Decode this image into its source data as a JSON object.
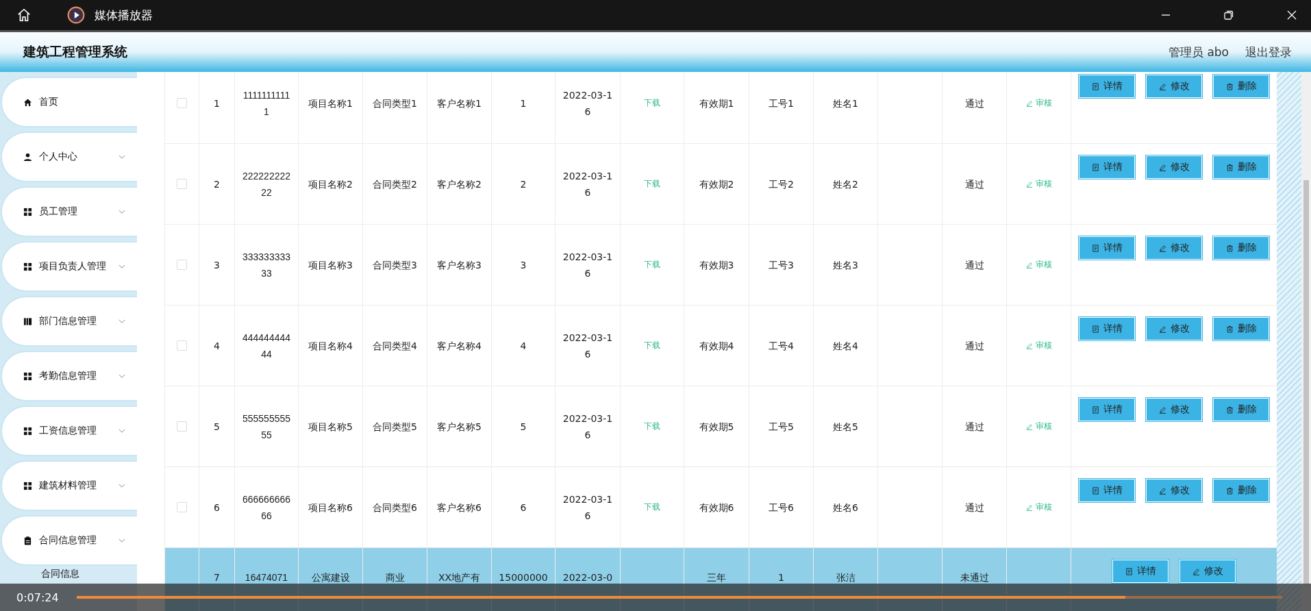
{
  "player": {
    "title": "媒体播放器",
    "time": "0:07:24",
    "level": 0.87
  },
  "header": {
    "title": "建筑工程管理系统",
    "user": "管理员 abo",
    "logout": "退出登录"
  },
  "sidebar": {
    "items": [
      {
        "label": "首页",
        "kind": "link"
      },
      {
        "label": "个人中心",
        "kind": "menu"
      },
      {
        "label": "员工管理",
        "kind": "menu"
      },
      {
        "label": "项目负责人管理",
        "kind": "menu"
      },
      {
        "label": "部门信息管理",
        "kind": "menu"
      },
      {
        "label": "考勤信息管理",
        "kind": "menu"
      },
      {
        "label": "工资信息管理",
        "kind": "menu"
      },
      {
        "label": "建筑材料管理",
        "kind": "menu"
      },
      {
        "label": "合同信息管理",
        "kind": "menu",
        "children": [
          {
            "label": "合同信息"
          }
        ]
      }
    ]
  },
  "table": {
    "rows": [
      {
        "selected": false,
        "checked": false,
        "index": "1",
        "number": "11111111111",
        "project": "项目名称1",
        "type": "合同类型1",
        "client": "客户名称1",
        "amount": "1",
        "date": "2022-03-16",
        "file": "下载",
        "validity": "有效期1",
        "work_no": "工号1",
        "name": "姓名1",
        "status": "通过",
        "audit": "审核",
        "actions": [
          "详情",
          "修改",
          "删除"
        ]
      },
      {
        "selected": false,
        "checked": false,
        "index": "2",
        "number": "22222222222",
        "project": "项目名称2",
        "type": "合同类型2",
        "client": "客户名称2",
        "amount": "2",
        "date": "2022-03-16",
        "file": "下载",
        "validity": "有效期2",
        "work_no": "工号2",
        "name": "姓名2",
        "status": "通过",
        "audit": "审核",
        "actions": [
          "详情",
          "修改",
          "删除"
        ]
      },
      {
        "selected": false,
        "checked": false,
        "index": "3",
        "number": "33333333333",
        "project": "项目名称3",
        "type": "合同类型3",
        "client": "客户名称3",
        "amount": "3",
        "date": "2022-03-16",
        "file": "下载",
        "validity": "有效期3",
        "work_no": "工号3",
        "name": "姓名3",
        "status": "通过",
        "audit": "审核",
        "actions": [
          "详情",
          "修改",
          "删除"
        ]
      },
      {
        "selected": false,
        "checked": false,
        "index": "4",
        "number": "44444444444",
        "project": "项目名称4",
        "type": "合同类型4",
        "client": "客户名称4",
        "amount": "4",
        "date": "2022-03-16",
        "file": "下载",
        "validity": "有效期4",
        "work_no": "工号4",
        "name": "姓名4",
        "status": "通过",
        "audit": "审核",
        "actions": [
          "详情",
          "修改",
          "删除"
        ]
      },
      {
        "selected": false,
        "checked": false,
        "index": "5",
        "number": "55555555555",
        "project": "项目名称5",
        "type": "合同类型5",
        "client": "客户名称5",
        "amount": "5",
        "date": "2022-03-16",
        "file": "下载",
        "validity": "有效期5",
        "work_no": "工号5",
        "name": "姓名5",
        "status": "通过",
        "audit": "审核",
        "actions": [
          "详情",
          "修改",
          "删除"
        ]
      },
      {
        "selected": false,
        "checked": false,
        "index": "6",
        "number": "66666666666",
        "project": "项目名称6",
        "type": "合同类型6",
        "client": "客户名称6",
        "amount": "6",
        "date": "2022-03-16",
        "file": "下载",
        "validity": "有效期6",
        "work_no": "工号6",
        "name": "姓名6",
        "status": "通过",
        "audit": "审核",
        "actions": [
          "详情",
          "修改",
          "删除"
        ]
      },
      {
        "selected": true,
        "index": "7",
        "number": "16474071",
        "project": "公寓建设",
        "type": "商业",
        "client": "XX地产有",
        "amount": "15000000",
        "date": "2022-03-0",
        "validity": "三年",
        "work_no": "1",
        "name": "张洁",
        "status": "未通过",
        "actions": [
          "详情",
          "修改"
        ]
      }
    ]
  }
}
